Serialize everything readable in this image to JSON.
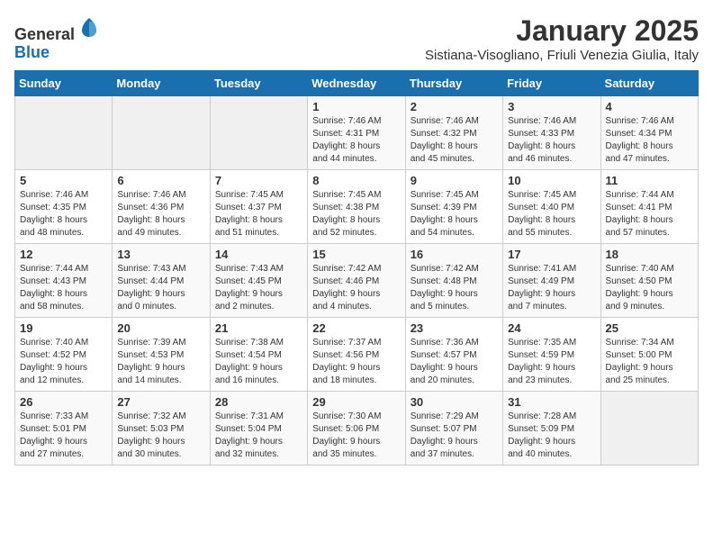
{
  "header": {
    "logo_line1": "General",
    "logo_line2": "Blue",
    "title": "January 2025",
    "subtitle": "Sistiana-Visogliano, Friuli Venezia Giulia, Italy"
  },
  "weekdays": [
    "Sunday",
    "Monday",
    "Tuesday",
    "Wednesday",
    "Thursday",
    "Friday",
    "Saturday"
  ],
  "weeks": [
    [
      {
        "day": "",
        "info": ""
      },
      {
        "day": "",
        "info": ""
      },
      {
        "day": "",
        "info": ""
      },
      {
        "day": "1",
        "info": "Sunrise: 7:46 AM\nSunset: 4:31 PM\nDaylight: 8 hours\nand 44 minutes."
      },
      {
        "day": "2",
        "info": "Sunrise: 7:46 AM\nSunset: 4:32 PM\nDaylight: 8 hours\nand 45 minutes."
      },
      {
        "day": "3",
        "info": "Sunrise: 7:46 AM\nSunset: 4:33 PM\nDaylight: 8 hours\nand 46 minutes."
      },
      {
        "day": "4",
        "info": "Sunrise: 7:46 AM\nSunset: 4:34 PM\nDaylight: 8 hours\nand 47 minutes."
      }
    ],
    [
      {
        "day": "5",
        "info": "Sunrise: 7:46 AM\nSunset: 4:35 PM\nDaylight: 8 hours\nand 48 minutes."
      },
      {
        "day": "6",
        "info": "Sunrise: 7:46 AM\nSunset: 4:36 PM\nDaylight: 8 hours\nand 49 minutes."
      },
      {
        "day": "7",
        "info": "Sunrise: 7:45 AM\nSunset: 4:37 PM\nDaylight: 8 hours\nand 51 minutes."
      },
      {
        "day": "8",
        "info": "Sunrise: 7:45 AM\nSunset: 4:38 PM\nDaylight: 8 hours\nand 52 minutes."
      },
      {
        "day": "9",
        "info": "Sunrise: 7:45 AM\nSunset: 4:39 PM\nDaylight: 8 hours\nand 54 minutes."
      },
      {
        "day": "10",
        "info": "Sunrise: 7:45 AM\nSunset: 4:40 PM\nDaylight: 8 hours\nand 55 minutes."
      },
      {
        "day": "11",
        "info": "Sunrise: 7:44 AM\nSunset: 4:41 PM\nDaylight: 8 hours\nand 57 minutes."
      }
    ],
    [
      {
        "day": "12",
        "info": "Sunrise: 7:44 AM\nSunset: 4:43 PM\nDaylight: 8 hours\nand 58 minutes."
      },
      {
        "day": "13",
        "info": "Sunrise: 7:43 AM\nSunset: 4:44 PM\nDaylight: 9 hours\nand 0 minutes."
      },
      {
        "day": "14",
        "info": "Sunrise: 7:43 AM\nSunset: 4:45 PM\nDaylight: 9 hours\nand 2 minutes."
      },
      {
        "day": "15",
        "info": "Sunrise: 7:42 AM\nSunset: 4:46 PM\nDaylight: 9 hours\nand 4 minutes."
      },
      {
        "day": "16",
        "info": "Sunrise: 7:42 AM\nSunset: 4:48 PM\nDaylight: 9 hours\nand 5 minutes."
      },
      {
        "day": "17",
        "info": "Sunrise: 7:41 AM\nSunset: 4:49 PM\nDaylight: 9 hours\nand 7 minutes."
      },
      {
        "day": "18",
        "info": "Sunrise: 7:40 AM\nSunset: 4:50 PM\nDaylight: 9 hours\nand 9 minutes."
      }
    ],
    [
      {
        "day": "19",
        "info": "Sunrise: 7:40 AM\nSunset: 4:52 PM\nDaylight: 9 hours\nand 12 minutes."
      },
      {
        "day": "20",
        "info": "Sunrise: 7:39 AM\nSunset: 4:53 PM\nDaylight: 9 hours\nand 14 minutes."
      },
      {
        "day": "21",
        "info": "Sunrise: 7:38 AM\nSunset: 4:54 PM\nDaylight: 9 hours\nand 16 minutes."
      },
      {
        "day": "22",
        "info": "Sunrise: 7:37 AM\nSunset: 4:56 PM\nDaylight: 9 hours\nand 18 minutes."
      },
      {
        "day": "23",
        "info": "Sunrise: 7:36 AM\nSunset: 4:57 PM\nDaylight: 9 hours\nand 20 minutes."
      },
      {
        "day": "24",
        "info": "Sunrise: 7:35 AM\nSunset: 4:59 PM\nDaylight: 9 hours\nand 23 minutes."
      },
      {
        "day": "25",
        "info": "Sunrise: 7:34 AM\nSunset: 5:00 PM\nDaylight: 9 hours\nand 25 minutes."
      }
    ],
    [
      {
        "day": "26",
        "info": "Sunrise: 7:33 AM\nSunset: 5:01 PM\nDaylight: 9 hours\nand 27 minutes."
      },
      {
        "day": "27",
        "info": "Sunrise: 7:32 AM\nSunset: 5:03 PM\nDaylight: 9 hours\nand 30 minutes."
      },
      {
        "day": "28",
        "info": "Sunrise: 7:31 AM\nSunset: 5:04 PM\nDaylight: 9 hours\nand 32 minutes."
      },
      {
        "day": "29",
        "info": "Sunrise: 7:30 AM\nSunset: 5:06 PM\nDaylight: 9 hours\nand 35 minutes."
      },
      {
        "day": "30",
        "info": "Sunrise: 7:29 AM\nSunset: 5:07 PM\nDaylight: 9 hours\nand 37 minutes."
      },
      {
        "day": "31",
        "info": "Sunrise: 7:28 AM\nSunset: 5:09 PM\nDaylight: 9 hours\nand 40 minutes."
      },
      {
        "day": "",
        "info": ""
      }
    ]
  ]
}
